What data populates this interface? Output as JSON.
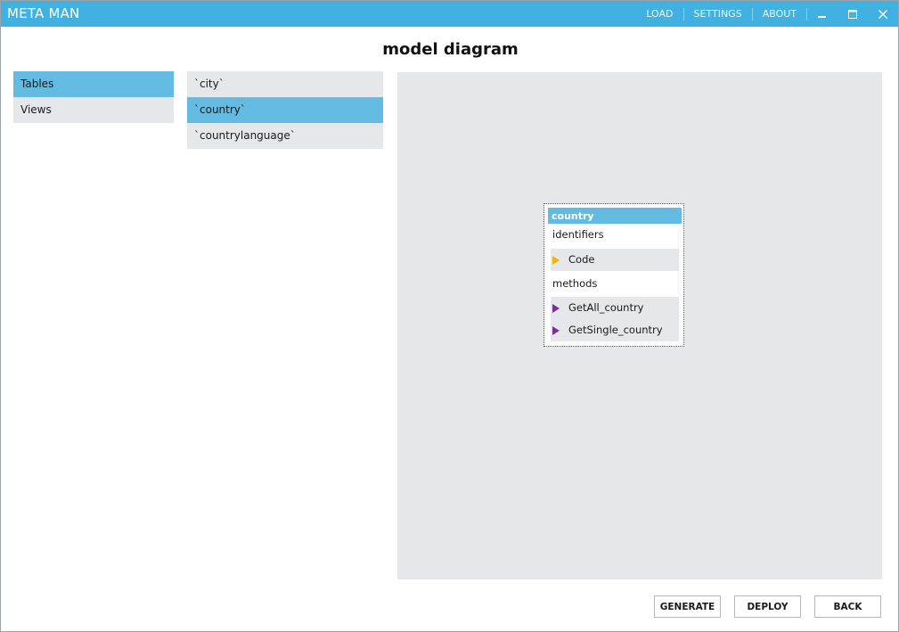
{
  "app": {
    "title": "META MAN"
  },
  "nav": {
    "load": "LOAD",
    "settings": "SETTINGS",
    "about": "ABOUT"
  },
  "page": {
    "heading": "model diagram"
  },
  "categories": [
    {
      "label": "Tables",
      "selected": true
    },
    {
      "label": "Views",
      "selected": false
    }
  ],
  "tables": [
    {
      "label": "`city`",
      "selected": false
    },
    {
      "label": "`country`",
      "selected": true
    },
    {
      "label": "`countrylanguage`",
      "selected": false
    }
  ],
  "entity": {
    "name": "country",
    "identifiers_label": "identifiers",
    "identifiers": [
      "Code"
    ],
    "methods_label": "methods",
    "methods": [
      "GetAll_country",
      "GetSingle_country"
    ]
  },
  "actions": {
    "generate": "GENERATE",
    "deploy": "DEPLOY",
    "back": "BACK"
  },
  "colors": {
    "titlebar": "#41b1e1",
    "selection": "#64bbe2",
    "panel": "#e6e7eb",
    "key_marker": "#f2b400",
    "method_marker": "#7a2f97"
  }
}
